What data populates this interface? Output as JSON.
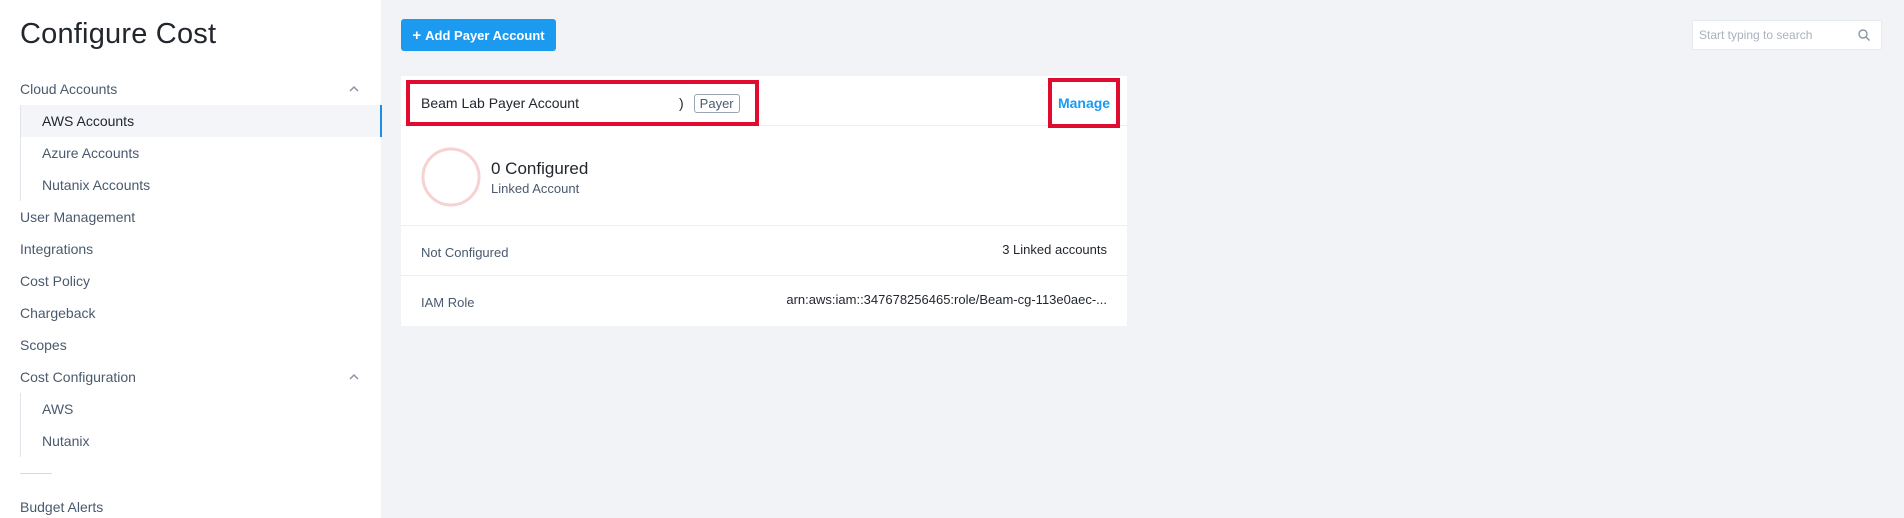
{
  "sidebar": {
    "title": "Configure Cost",
    "groups": [
      {
        "label": "Cloud Accounts",
        "items": [
          {
            "label": "AWS Accounts"
          },
          {
            "label": "Azure Accounts"
          },
          {
            "label": "Nutanix Accounts"
          }
        ]
      },
      {
        "label": "User Management"
      },
      {
        "label": "Integrations"
      },
      {
        "label": "Cost Policy"
      },
      {
        "label": "Chargeback"
      },
      {
        "label": "Scopes"
      },
      {
        "label": "Cost Configuration",
        "items": [
          {
            "label": "AWS"
          },
          {
            "label": "Nutanix"
          }
        ]
      },
      {
        "label": "Budget Alerts"
      }
    ],
    "active_item": "AWS Accounts"
  },
  "toolbar": {
    "add_button_label": "Add Payer Account",
    "search_placeholder": "Start typing to search"
  },
  "card": {
    "account_name": "Beam Lab Payer Account",
    "account_id_suffix": ")",
    "badge": "Payer",
    "manage_label": "Manage",
    "configured_count": "0 Configured",
    "configured_label": "Linked Account",
    "rows": [
      {
        "label": "Not Configured",
        "value": "3 Linked accounts"
      },
      {
        "label": "IAM Role",
        "value": "arn:aws:iam::347678256465:role/Beam-cg-113e0aec-..."
      }
    ]
  },
  "colors": {
    "accent": "#1b9af0",
    "highlight": "#e00b2e",
    "ring": "#f7d2d2"
  }
}
